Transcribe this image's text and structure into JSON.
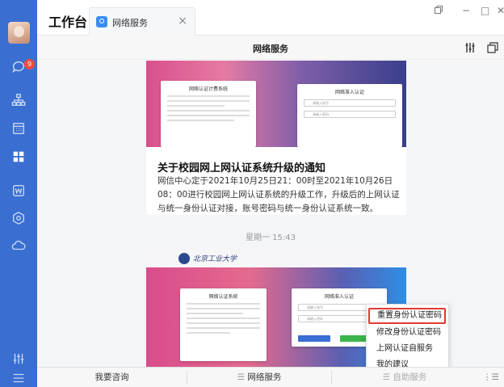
{
  "app": {
    "title": "工作台"
  },
  "tab": {
    "label": "网络服务",
    "close": "×"
  },
  "window_controls": {
    "minimize": "−",
    "maximize": "□",
    "close": "✕"
  },
  "subheader": {
    "title": "网络服务"
  },
  "sidebar": {
    "badge_count": "9",
    "items": [
      {
        "icon": "chat-bubble-icon"
      },
      {
        "icon": "org-chart-icon"
      },
      {
        "icon": "calendar-icon"
      },
      {
        "icon": "grid-apps-icon"
      },
      {
        "icon": "word-doc-icon"
      },
      {
        "icon": "hexagon-icon"
      },
      {
        "icon": "cloud-icon"
      },
      {
        "icon": "tuning-icon"
      },
      {
        "icon": "menu-icon"
      }
    ]
  },
  "messages": [
    {
      "banner": {
        "left_window_title": "网络认证计费系统",
        "right_window_title": "网络准入认证",
        "input_user": "请输入账号",
        "input_pwd": "请输入密码"
      },
      "title": "关于校园网上网认证系统升级的通知",
      "body": "网信中心定于2021年10月25日21：00时至2021年10月26日08：00进行校园网上网认证系统的升级工作，升级后的上网认证与统一身份认证对接，账号密码与统一身份认证系统一致。"
    },
    {
      "timestamp": "星期一 15:43",
      "banner": {
        "logo_text": "北京工业大学",
        "left_window_title": "网络认证系统",
        "right_window_title": "网络准入认证",
        "input_user": "请输入账号",
        "input_pwd": "请输入密码"
      }
    }
  ],
  "context_menu": {
    "items": [
      "重置身份认证密码",
      "修改身份认证密码",
      "上网认证自服务",
      "我的建议"
    ]
  },
  "bottom_bar": {
    "items": [
      "我要咨询",
      "网络服务",
      "自助服务"
    ]
  },
  "colors": {
    "sidebar": "#3a6fd1",
    "highlight": "#e03a31",
    "accent": "#3a8cf5"
  }
}
